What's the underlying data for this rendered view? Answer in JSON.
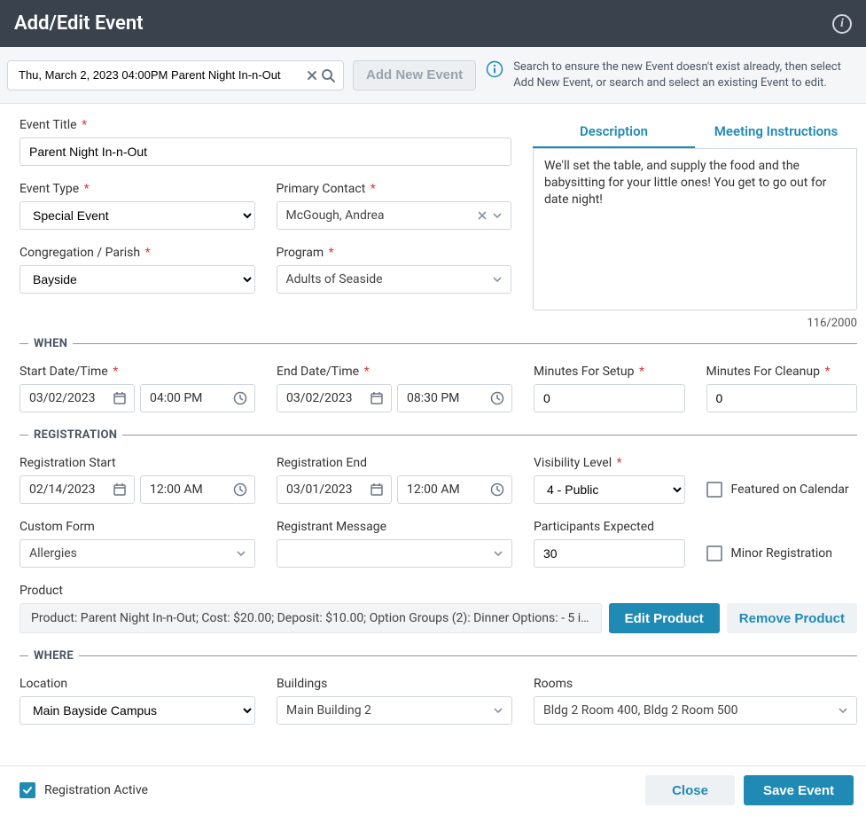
{
  "header": {
    "title": "Add/Edit Event"
  },
  "search": {
    "value": "Thu, March 2, 2023 04:00PM Parent Night In-n-Out",
    "add_button": "Add New Event",
    "hint": "Search to ensure the new Event doesn't exist already, then select Add New Event, or search and select an existing Event to edit."
  },
  "fields": {
    "event_title": {
      "label": "Event Title",
      "value": "Parent Night In-n-Out"
    },
    "event_type": {
      "label": "Event Type",
      "value": "Special Event"
    },
    "primary_contact": {
      "label": "Primary Contact",
      "value": "McGough, Andrea"
    },
    "congregation": {
      "label": "Congregation / Parish",
      "value": "Bayside"
    },
    "program": {
      "label": "Program",
      "value": "Adults of Seaside"
    }
  },
  "tabs": {
    "description": "Description",
    "meeting": "Meeting Instructions",
    "desc_text": "We'll set the table, and supply the food and the babysitting for your little ones! You get to go out for date night!",
    "count": "116/2000"
  },
  "sections": {
    "when": "WHEN",
    "registration": "REGISTRATION",
    "where": "WHERE"
  },
  "when": {
    "start_label": "Start Date/Time",
    "end_label": "End Date/Time",
    "setup_label": "Minutes For Setup",
    "cleanup_label": "Minutes For Cleanup",
    "start_date": "03/02/2023",
    "start_time": "04:00 PM",
    "end_date": "03/02/2023",
    "end_time": "08:30 PM",
    "setup": "0",
    "cleanup": "0"
  },
  "reg": {
    "start_label": "Registration Start",
    "end_label": "Registration End",
    "vis_label": "Visibility Level",
    "featured_label": "Featured on Calendar",
    "custom_form_label": "Custom Form",
    "registrant_msg_label": "Registrant Message",
    "participants_label": "Participants Expected",
    "minor_label": "Minor Registration",
    "start_date": "02/14/2023",
    "start_time": "12:00 AM",
    "end_date": "03/01/2023",
    "end_time": "12:00 AM",
    "visibility": "4 - Public",
    "custom_form": "Allergies",
    "registrant_msg": "",
    "participants": "30",
    "product_label": "Product",
    "product_text": "Product: Parent Night In-n-Out; Cost: $20.00; Deposit: $10.00; Option Groups (2): Dinner Options: - 5 ite…",
    "edit_product": "Edit Product",
    "remove_product": "Remove Product"
  },
  "where": {
    "location_label": "Location",
    "buildings_label": "Buildings",
    "rooms_label": "Rooms",
    "location": "Main Bayside Campus",
    "buildings": "Main Building 2",
    "rooms": "Bldg 2 Room 400, Bldg 2 Room 500"
  },
  "footer": {
    "reg_active": "Registration Active",
    "close": "Close",
    "save": "Save Event"
  }
}
